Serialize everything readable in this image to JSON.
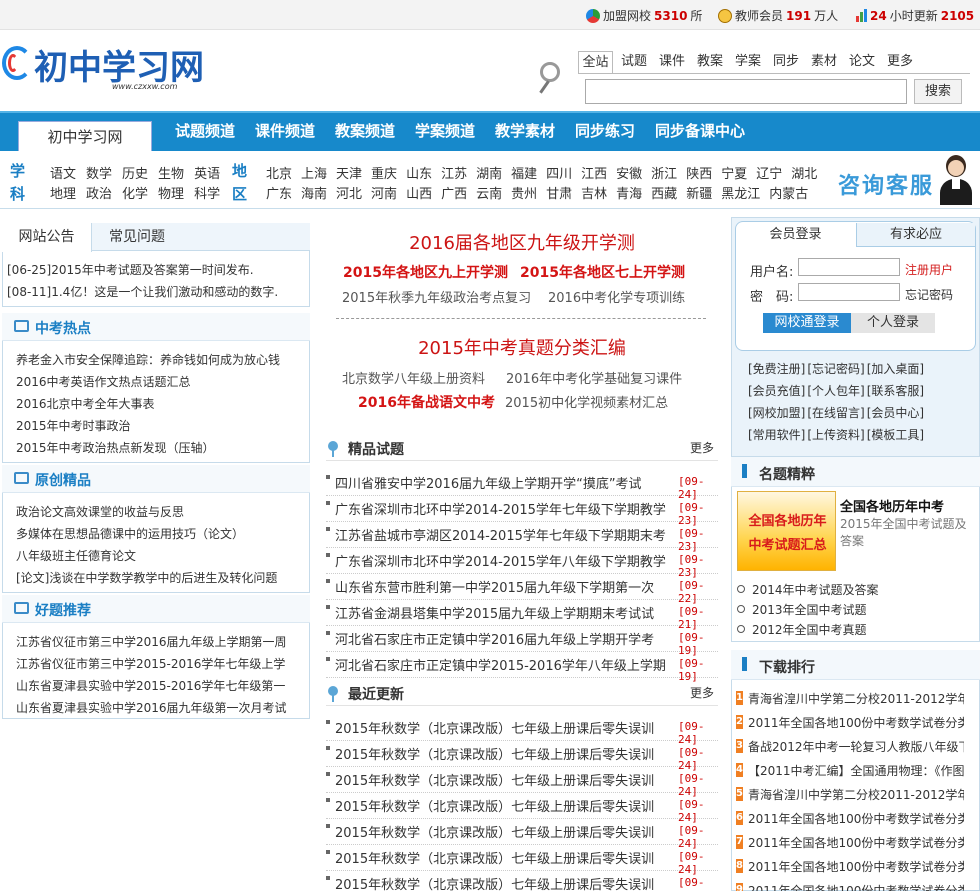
{
  "topbar": {
    "stat1_label": "加盟网校",
    "stat1_num": "5310",
    "stat1_unit": "所",
    "stat2_label": "教师会员",
    "stat2_num": "191",
    "stat2_unit": "万人",
    "stat3_num": "24",
    "stat3_label": "小时更新",
    "stat3_num2": "2105"
  },
  "logo": {
    "text": "初中学习网",
    "url": "www.czxxw.com"
  },
  "search": {
    "tabs": [
      "全站",
      "试题",
      "课件",
      "教案",
      "学案",
      "同步",
      "素材",
      "论文",
      "更多"
    ],
    "button": "搜索",
    "value": ""
  },
  "nav": {
    "home": "初中学习网",
    "items": [
      "试题频道",
      "课件频道",
      "教案频道",
      "学案频道",
      "教学素材",
      "同步练习",
      "同步备课中心"
    ]
  },
  "band": {
    "subject_label_1": "学",
    "subject_label_2": "科",
    "subjects_row1": [
      "语文",
      "数学",
      "历史",
      "生物",
      "英语"
    ],
    "subjects_row2": [
      "地理",
      "政治",
      "化学",
      "物理",
      "科学"
    ],
    "area_label_1": "地",
    "area_label_2": "区",
    "areas_row1": [
      "北京",
      "上海",
      "天津",
      "重庆",
      "山东",
      "江苏",
      "湖南",
      "福建",
      "四川",
      "江西",
      "安徽",
      "浙江",
      "陕西",
      "宁夏",
      "辽宁",
      "湖北"
    ],
    "areas_row2": [
      "广东",
      "海南",
      "河北",
      "河南",
      "山西",
      "广西",
      "云南",
      "贵州",
      "甘肃",
      "吉林",
      "青海",
      "西藏",
      "新疆",
      "黑龙江",
      "内蒙古"
    ],
    "consult": "咨询客服"
  },
  "notice": {
    "tabs": [
      "网站公告",
      "常见问题"
    ],
    "items": [
      {
        "date": "[06-25]",
        "text": "2015年中考试题及答案第一时间发布."
      },
      {
        "date": "[08-11]",
        "text": "1.4亿！这是一个让我们激动和感动的数字."
      }
    ]
  },
  "hot": {
    "title": "中考热点",
    "items": [
      "养老金入市安全保障追踪：养命钱如何成为放心钱",
      "2016中考英语作文热点话题汇总",
      "2016北京中考全年大事表",
      "2015年中考时事政治",
      "2015年中考政治热点新发现（压轴）"
    ]
  },
  "original": {
    "title": "原创精品",
    "items": [
      "政治论文高效课堂的收益与反思",
      "多媒体在思想品德课中的运用技巧（论文）",
      "八年级班主任德育论文",
      "[论文]浅谈在中学数学教学中的后进生及转化问题"
    ]
  },
  "good": {
    "title": "好题推荐",
    "items": [
      "江苏省仪征市第三中学2016届九年级上学期第一周",
      "江苏省仪征市第三中学2015-2016学年七年级上学",
      "山东省夏津县实验中学2015-2016学年七年级第一",
      "山东省夏津县实验中学2016届九年级第一次月考试"
    ]
  },
  "center": {
    "headline1": "2016届各地区九年级开学测",
    "bold1": "2015年各地区九上开学测",
    "bold2": "2015年各地区七上开学测",
    "sub1": "2015年秋季九年级政治考点复习",
    "sub2": "2016中考化学专项训练",
    "headline2": "2015年中考真题分类汇编",
    "sub3": "北京数学八年级上册资料",
    "sub4": "2016年中考化学基础复习课件",
    "bold3": "2016年备战语文中考",
    "sub5": "2015初中化学视频素材汇总",
    "sec1_title": "精品试题",
    "sec1_more": "更多",
    "sec1_items": [
      {
        "text": "四川省雅安中学2016届九年级上学期开学“摸底”考试",
        "date": "[09-24]"
      },
      {
        "text": "广东省深圳市北环中学2014-2015学年七年级下学期教学",
        "date": "[09-23]"
      },
      {
        "text": "江苏省盐城市亭湖区2014-2015学年七年级下学期期末考",
        "date": "[09-23]"
      },
      {
        "text": "广东省深圳市北环中学2014-2015学年八年级下学期教学",
        "date": "[09-23]"
      },
      {
        "text": "山东省东营市胜利第一中学2015届九年级下学期第一次",
        "date": "[09-22]"
      },
      {
        "text": "江苏省金湖县塔集中学2015届九年级上学期期末考试试",
        "date": "[09-21]"
      },
      {
        "text": "河北省石家庄市正定镇中学2016届九年级上学期开学考",
        "date": "[09-19]"
      },
      {
        "text": "河北省石家庄市正定镇中学2015-2016学年八年级上学期",
        "date": "[09-19]"
      }
    ],
    "sec2_title": "最近更新",
    "sec2_more": "更多",
    "sec2_items": [
      {
        "text": "2015年秋数学（北京课改版）七年级上册课后零失误训",
        "date": "[09-24]"
      },
      {
        "text": "2015年秋数学（北京课改版）七年级上册课后零失误训",
        "date": "[09-24]"
      },
      {
        "text": "2015年秋数学（北京课改版）七年级上册课后零失误训",
        "date": "[09-24]"
      },
      {
        "text": "2015年秋数学（北京课改版）七年级上册课后零失误训",
        "date": "[09-24]"
      },
      {
        "text": "2015年秋数学（北京课改版）七年级上册课后零失误训",
        "date": "[09-24]"
      },
      {
        "text": "2015年秋数学（北京课改版）七年级上册课后零失误训",
        "date": "[09-24]"
      },
      {
        "text": "2015年秋数学（北京课改版）七年级上册课后零失误训",
        "date": "[09-24]"
      }
    ]
  },
  "login": {
    "tabs": [
      "会员登录",
      "有求必应"
    ],
    "username_label": "用户名:",
    "password_label": "密　码:",
    "register": "注册用户",
    "forgot": "忘记密码",
    "btn1": "网校通登录",
    "btn2": "个人登录",
    "links": [
      [
        "[免费注册]",
        "[忘记密码]",
        "[加入桌面]"
      ],
      [
        "[会员充值]",
        "[个人包年]",
        "[联系客服]"
      ],
      [
        "[网校加盟]",
        "[在线留言]",
        "[会员中心]"
      ],
      [
        "[常用软件]",
        "[上传资料]",
        "[模板工具]"
      ]
    ]
  },
  "famous": {
    "title": "名题精粹",
    "img_line1": "全国各地历年",
    "img_line2": "中考试题汇总",
    "headline": "全国各地历年中考",
    "desc": "2015年全国中考试题及答案",
    "items": [
      "2014年中考试题及答案",
      "2013年全国中考试题",
      "2012年全国中考真题"
    ]
  },
  "download": {
    "title": "下载排行",
    "items": [
      {
        "rank": "1",
        "text": "青海省湟川中学第二分校2011-2012学年"
      },
      {
        "rank": "2",
        "text": "2011年全国各地100份中考数学试卷分类"
      },
      {
        "rank": "3",
        "text": "备战2012年中考一轮复习人教版八年级下册"
      },
      {
        "rank": "4",
        "text": "【2011中考汇编】全国通用物理：《作图"
      },
      {
        "rank": "5",
        "text": "青海省湟川中学第二分校2011-2012学年"
      },
      {
        "rank": "6",
        "text": "2011年全国各地100份中考数学试卷分类"
      },
      {
        "rank": "7",
        "text": "2011年全国各地100份中考数学试卷分类"
      },
      {
        "rank": "8",
        "text": "2011年全国各地100份中考数学试卷分类"
      },
      {
        "rank": "9",
        "text": "2011年全国各地100份中考数学试卷分类"
      }
    ]
  },
  "colors": {
    "nav_blue": "#1789cb",
    "accent_red": "#cc1414",
    "rank_orange": "#f07f22",
    "title_blue": "#1b7fc4"
  }
}
